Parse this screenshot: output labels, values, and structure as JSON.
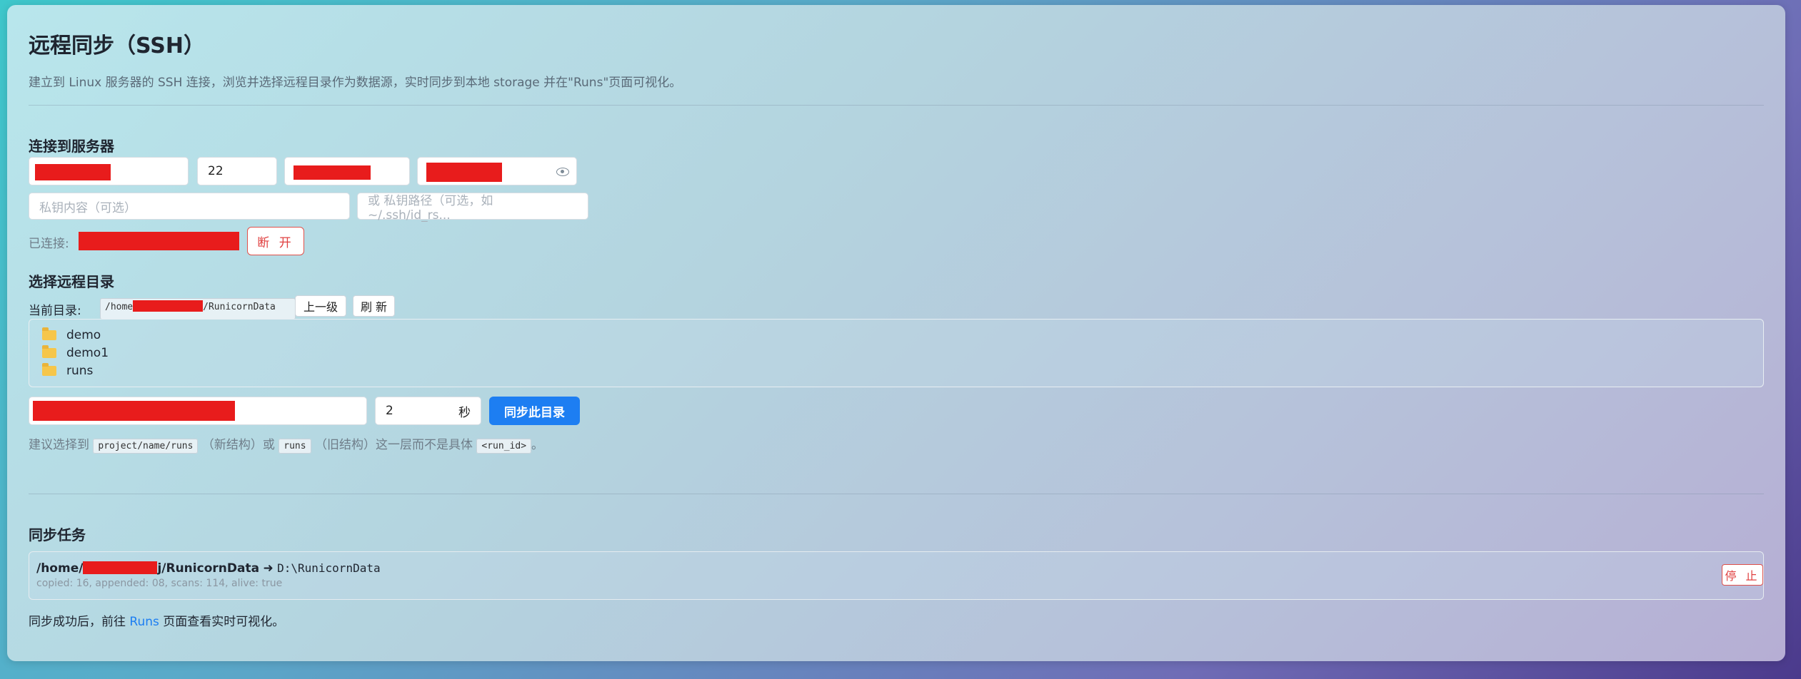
{
  "header": {
    "title": "远程同步（SSH）",
    "subtitle": "建立到 Linux 服务器的 SSH 连接，浏览并选择远程目录作为数据源，实时同步到本地 storage 并在\"Runs\"页面可视化。"
  },
  "connect": {
    "section_title": "连接到服务器",
    "port_value": "22",
    "private_key_placeholder": "私钥内容（可选）",
    "key_path_placeholder": "或 私钥路径（可选，如 ~/.ssh/id_rs...",
    "connected_label": "已连接:",
    "disconnect_label": "断 开"
  },
  "browser": {
    "section_title": "选择远程目录",
    "current_dir_label": "当前目录:",
    "current_dir_prefix": "/home",
    "current_dir_suffix": "/RunicornData",
    "up_label": "上一级",
    "refresh_label": "刷 新",
    "items": [
      "demo",
      "demo1",
      "runs"
    ],
    "interval_value": "2",
    "interval_unit": "秒",
    "sync_button_label": "同步此目录",
    "hint_prefix": "建议选择到",
    "hint_code1": "project/name/runs",
    "hint_mid1": "（新结构）或",
    "hint_code2": "runs",
    "hint_mid2": "（旧结构）这一层而不是具体",
    "hint_code3": "<run_id>",
    "hint_suffix": "。"
  },
  "tasks": {
    "section_title": "同步任务",
    "task_path_prefix": "/home/",
    "task_path_suffix": "j/RunicornData",
    "task_arrow": "➜",
    "task_target": "D:\\RunicornData",
    "task_stats": "copied: 16, appended: 08, scans: 114, alive: true",
    "stop_label": "停 止",
    "footer_prefix": "同步成功后，前往",
    "footer_link": "Runs",
    "footer_suffix": "页面查看实时可视化。"
  },
  "colors": {
    "primary": "#1d7ef2",
    "danger": "#e04040",
    "redaction": "#e81c1c"
  }
}
